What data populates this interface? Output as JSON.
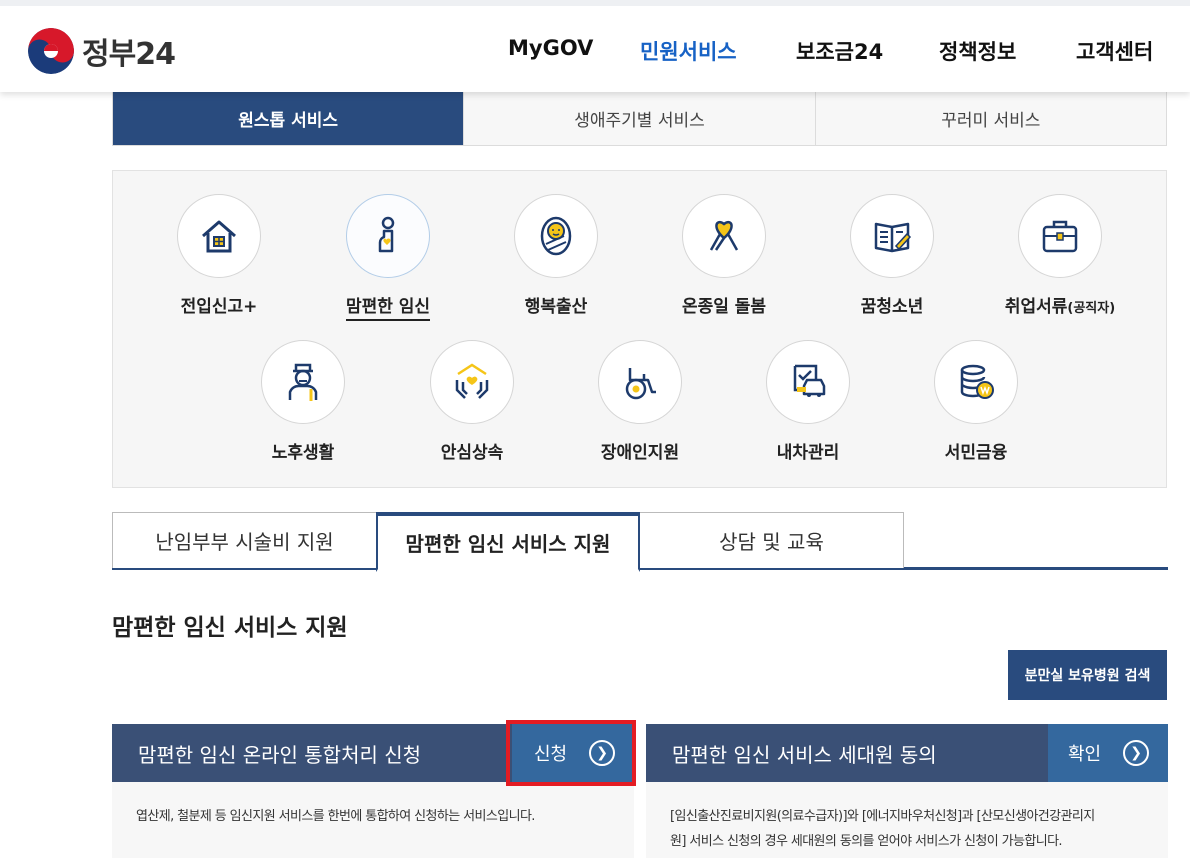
{
  "header": {
    "logo_text": "정부24",
    "nav": [
      {
        "label": "MyGOV"
      },
      {
        "label": "민원서비스"
      },
      {
        "label": "보조금24"
      },
      {
        "label": "정책정보"
      },
      {
        "label": "고객센터"
      }
    ]
  },
  "top_tabs": [
    "원스톱 서비스",
    "생애주기별 서비스",
    "꾸러미 서비스"
  ],
  "services_row1": [
    "전입신고+",
    "맘편한 임신",
    "행복출산",
    "온종일 돌봄",
    "꿈청소년",
    "취업서류"
  ],
  "services_row1_suffix": "(공직자)",
  "services_row2": [
    "노후생활",
    "안심상속",
    "장애인지원",
    "내차관리",
    "서민금융"
  ],
  "sub_tabs": [
    "난임부부 시술비 지원",
    "맘편한 임신 서비스 지원",
    "상담 및 교육"
  ],
  "section_title": "맘편한 임신 서비스 지원",
  "search_button": "분만실 보유병원 검색",
  "cards": [
    {
      "title": "맘편한 임신 온라인 통합처리 신청",
      "button": "신청",
      "desc": "엽산제, 철분제 등 임신지원 서비스를 한번에 통합하여 신청하는 서비스입니다."
    },
    {
      "title": "맘편한 임신 서비스 세대원 동의",
      "button": "확인",
      "desc_line1": "[임신출산진료비지원(의료수급자)]와 [에너지바우처신청]과 [산모신생아건강관리지",
      "desc_line2": "원] 서비스 신청의 경우 세대원의 동의를 얻어야 서비스가 신청이 가능합니다."
    }
  ],
  "colors": {
    "brand_navy": "#294b7e",
    "nav_active": "#1762c5",
    "card_head": "#3a5076",
    "card_button": "#34689e",
    "highlight": "#e31c23",
    "icon_yellow": "#f5c518"
  }
}
